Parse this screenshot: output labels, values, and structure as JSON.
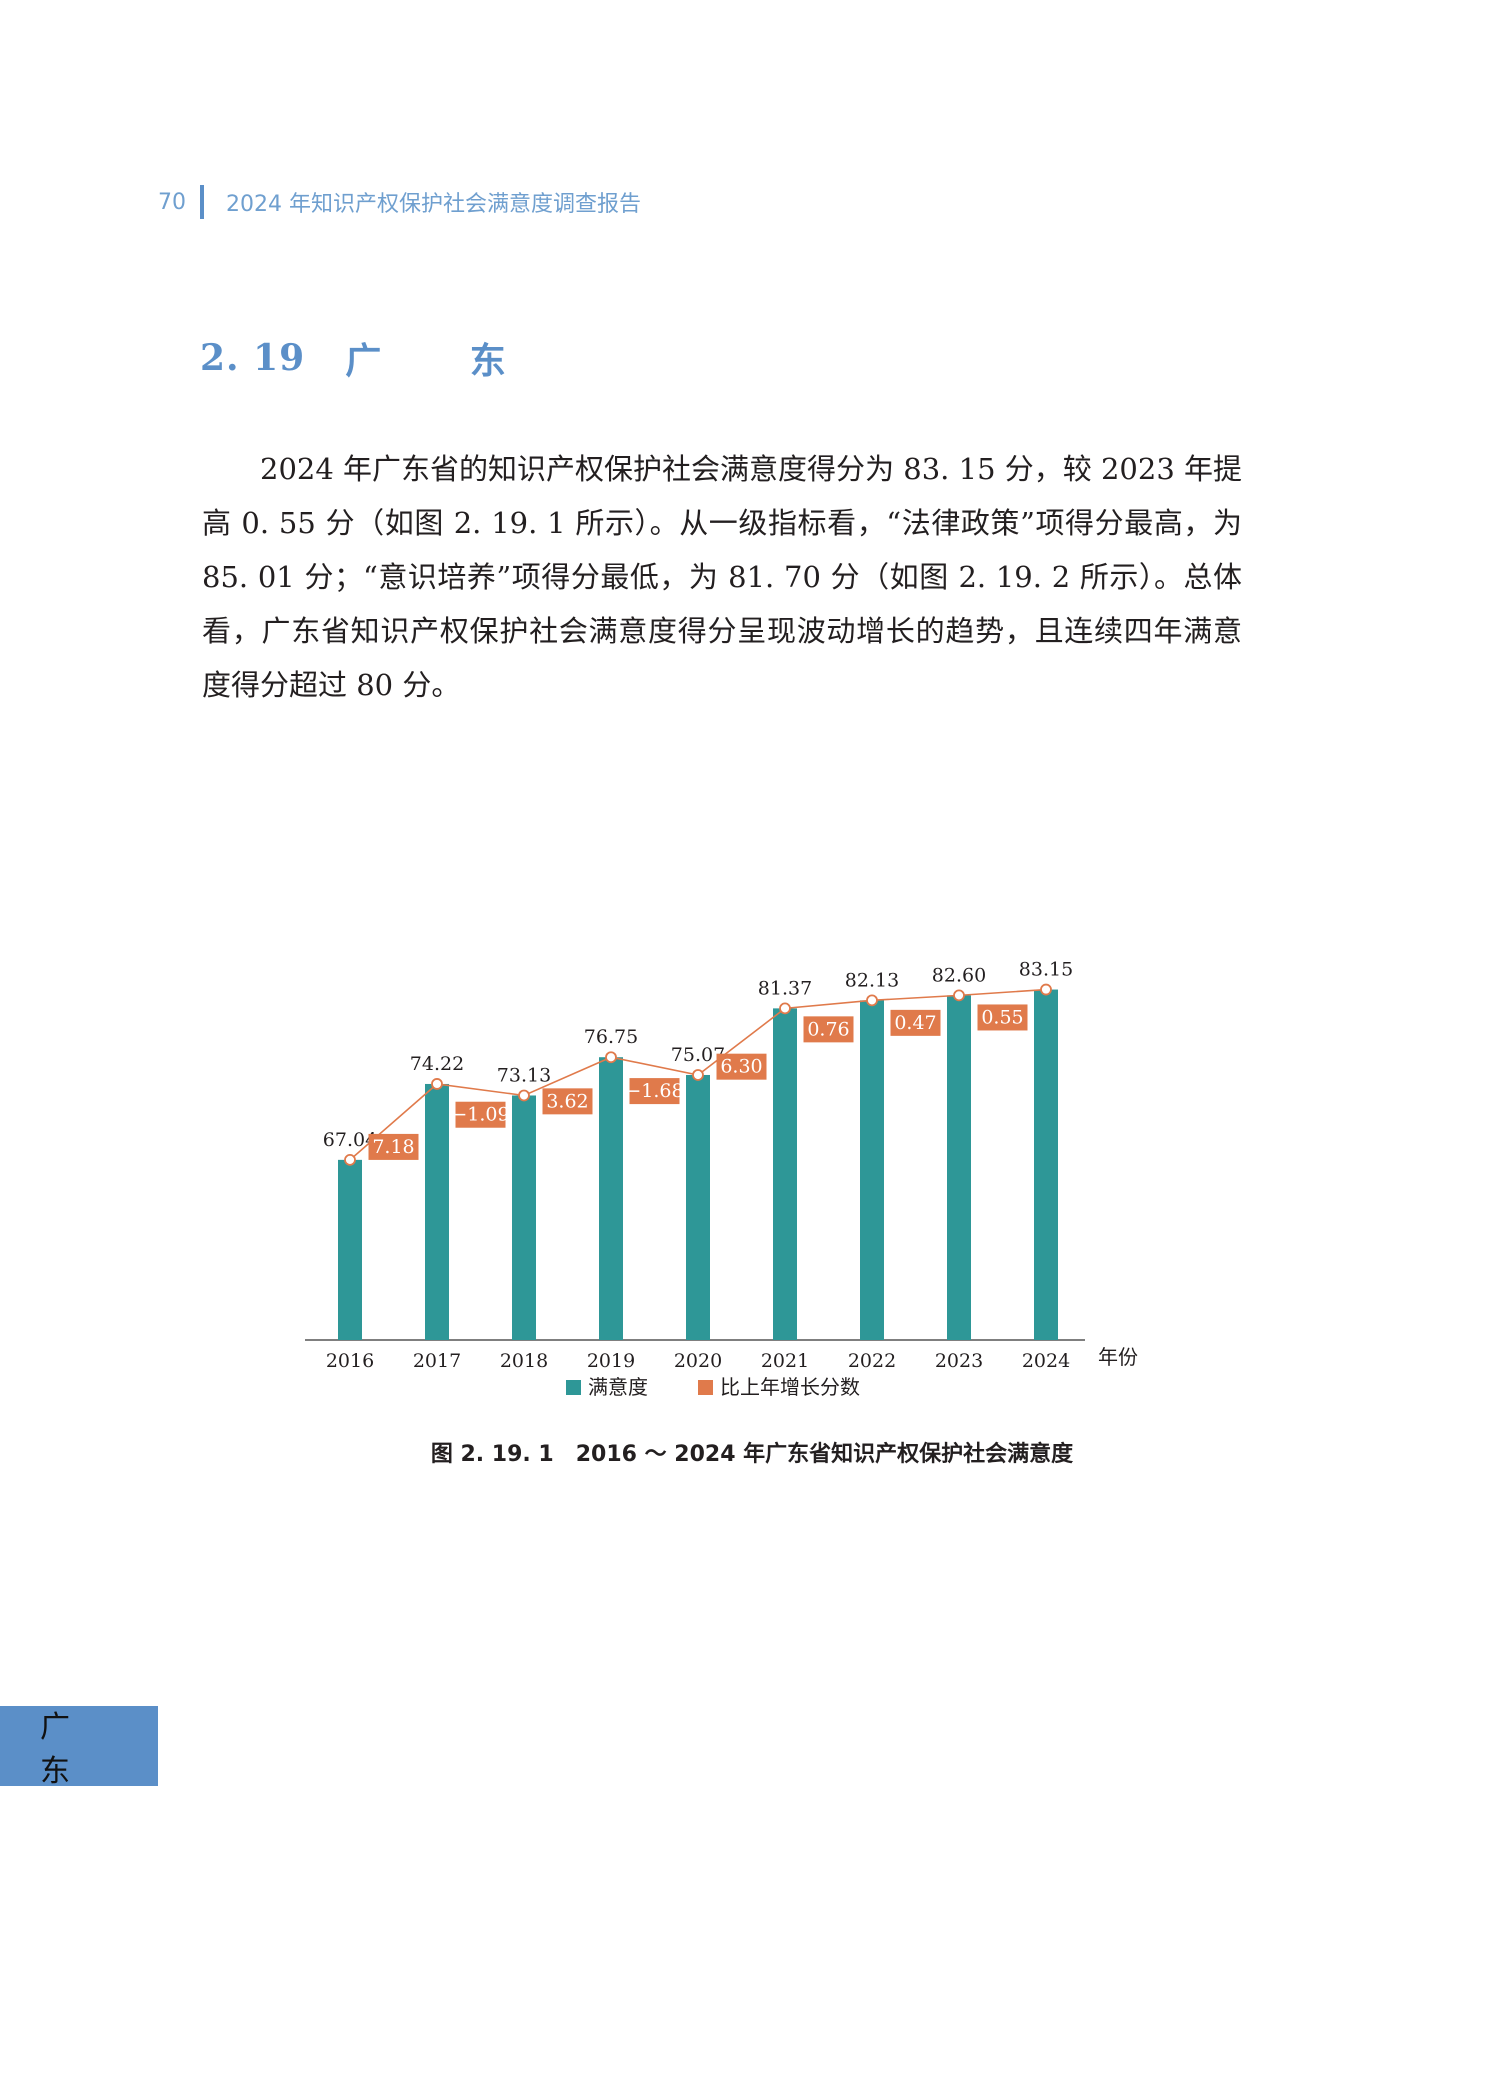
{
  "header": {
    "page_number": "70",
    "report_title": "2024 年知识产权保护社会满意度调查报告"
  },
  "section": {
    "number": "2. 19",
    "title": "广 东"
  },
  "paragraph": "2024 年广东省的知识产权保护社会满意度得分为 83. 15 分，较 2023 年提高 0. 55 分（如图 2. 19. 1 所示）。从一级指标看，“法律政策”项得分最高，为 85. 01 分；“意识培养”项得分最低，为 81. 70 分（如图 2. 19. 2 所示）。总体看，广东省知识产权保护社会满意度得分呈现波动增长的趋势，且连续四年满意度得分超过 80 分。",
  "figure_caption": "图 2. 19. 1　2016 ～ 2024 年广东省知识产权保护社会满意度",
  "side_tab": "广 东",
  "colors": {
    "bar": "#2e9797",
    "growth": "#e07a4b",
    "accent": "#5b8fc8"
  },
  "chart_data": {
    "type": "bar",
    "categories": [
      "2016",
      "2017",
      "2018",
      "2019",
      "2020",
      "2021",
      "2022",
      "2023",
      "2024"
    ],
    "x_unit_label": "年份",
    "series": [
      {
        "name": "满意度",
        "values": [
          67.04,
          74.22,
          73.13,
          76.75,
          75.07,
          81.37,
          82.13,
          82.6,
          83.15
        ],
        "labels": [
          "67.04",
          "74.22",
          "73.13",
          "76.75",
          "75.07",
          "81.37",
          "82.13",
          "82.60",
          "83.15"
        ]
      },
      {
        "name": "比上年增长分数",
        "values": [
          7.18,
          -1.09,
          3.62,
          -1.68,
          6.3,
          0.76,
          0.47,
          0.55
        ],
        "labels": [
          "7.18",
          "−1.09",
          "3.62",
          "−1.68",
          "6.30",
          "0.76",
          "0.47",
          "0.55"
        ]
      }
    ],
    "legend_position": "bottom",
    "grid": false
  }
}
